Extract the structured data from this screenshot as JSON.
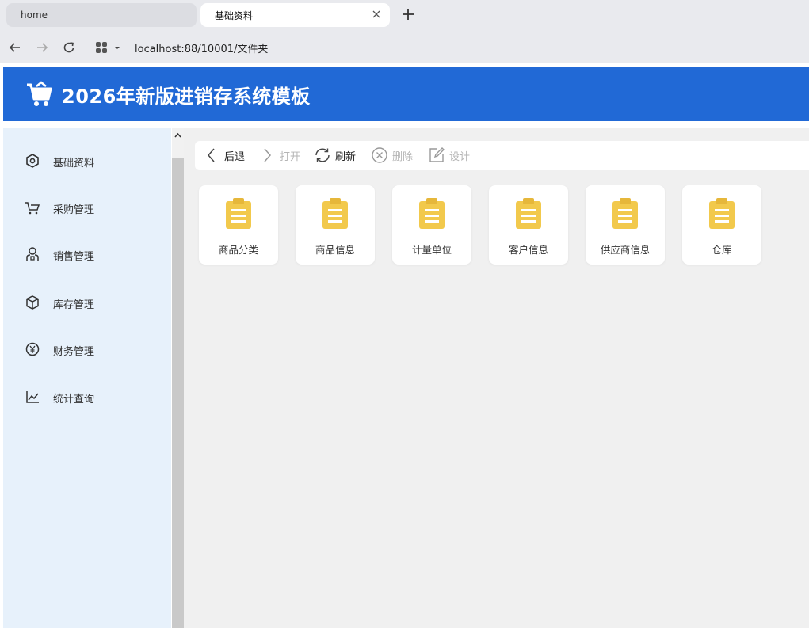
{
  "browser": {
    "tabs": [
      {
        "label": "home"
      },
      {
        "label": "基础资料"
      }
    ],
    "url": "localhost:88/10001/文件夹"
  },
  "app": {
    "title": "2026年新版进销存系统模板",
    "header_color": "#2169d6"
  },
  "sidebar": {
    "items": [
      {
        "label": "基础资料",
        "icon": "hexagon-settings-icon"
      },
      {
        "label": "采购管理",
        "icon": "cart-icon"
      },
      {
        "label": "销售管理",
        "icon": "user-icon"
      },
      {
        "label": "库存管理",
        "icon": "box-icon"
      },
      {
        "label": "财务管理",
        "icon": "yen-icon"
      },
      {
        "label": "统计查询",
        "icon": "line-chart-icon"
      }
    ]
  },
  "toolbar": {
    "back": "后退",
    "open": "打开",
    "refresh": "刷新",
    "delete": "删除",
    "design": "设计"
  },
  "cards": [
    {
      "label": "商品分类",
      "icon": "clipboard-icon"
    },
    {
      "label": "商品信息",
      "icon": "clipboard-icon"
    },
    {
      "label": "计量单位",
      "icon": "clipboard-icon"
    },
    {
      "label": "客户信息",
      "icon": "clipboard-icon"
    },
    {
      "label": "供应商信息",
      "icon": "clipboard-icon"
    },
    {
      "label": "仓库",
      "icon": "clipboard-icon"
    }
  ],
  "colors": {
    "clipboard": "#f2c94c",
    "sidebar_bg": "#e7f1fb",
    "content_bg": "#f0f0f0"
  }
}
